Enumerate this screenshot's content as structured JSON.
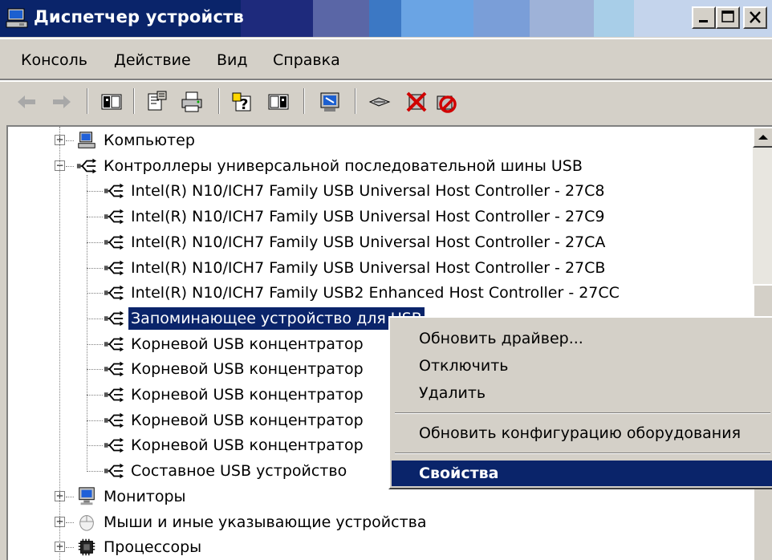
{
  "window": {
    "title": "Диспетчер устройств",
    "title_bar_colors": [
      "#0a246a",
      "#1e2a7c",
      "#3a4690",
      "#5a66a6",
      "#7a8ed0",
      "#3c78c4",
      "#6aa4e4",
      "#9eb2d8",
      "#b4c0e4",
      "#a8cee8",
      "#d8e4f4"
    ],
    "controls": [
      "minimize-icon",
      "maximize-icon",
      "close-icon"
    ]
  },
  "menu": {
    "items": [
      "Консоль",
      "Действие",
      "Вид",
      "Справка"
    ]
  },
  "toolbar": {
    "buttons": [
      "back-arrow-icon",
      "forward-arrow-icon",
      "show-hide-tree-icon",
      "properties-icon",
      "print-icon",
      "help-icon",
      "show-hide-action-pane-icon",
      "scan-hardware-icon",
      "update-driver-icon",
      "uninstall-icon",
      "disable-icon"
    ]
  },
  "tree": {
    "items": [
      {
        "label": "Компьютер",
        "icon": "computer-icon",
        "level": 0,
        "expander": "+"
      },
      {
        "label": "Контроллеры универсальной последовательной шины USB",
        "icon": "usb-icon",
        "level": 0,
        "expander": "−"
      },
      {
        "label": "Intel(R) N10/ICH7 Family USB Universal Host Controller - 27C8",
        "icon": "usb-icon",
        "level": 1
      },
      {
        "label": "Intel(R) N10/ICH7 Family USB Universal Host Controller - 27C9",
        "icon": "usb-icon",
        "level": 1
      },
      {
        "label": "Intel(R) N10/ICH7 Family USB Universal Host Controller - 27CA",
        "icon": "usb-icon",
        "level": 1
      },
      {
        "label": "Intel(R) N10/ICH7 Family USB Universal Host Controller - 27CB",
        "icon": "usb-icon",
        "level": 1
      },
      {
        "label": "Intel(R) N10/ICH7 Family USB2 Enhanced Host Controller - 27CC",
        "icon": "usb-icon",
        "level": 1
      },
      {
        "label": "Запоминающее устройство для USB",
        "icon": "usb-icon",
        "level": 1,
        "selected": true
      },
      {
        "label": "Корневой USB концентратор",
        "icon": "usb-icon",
        "level": 1
      },
      {
        "label": "Корневой USB концентратор",
        "icon": "usb-icon",
        "level": 1
      },
      {
        "label": "Корневой USB концентратор",
        "icon": "usb-icon",
        "level": 1
      },
      {
        "label": "Корневой USB концентратор",
        "icon": "usb-icon",
        "level": 1
      },
      {
        "label": "Корневой USB концентратор",
        "icon": "usb-icon",
        "level": 1
      },
      {
        "label": "Составное USB устройство",
        "icon": "usb-icon",
        "level": 1
      },
      {
        "label": "Мониторы",
        "icon": "monitor-icon",
        "level": 0,
        "expander": "+"
      },
      {
        "label": "Мыши и иные указывающие устройства",
        "icon": "mouse-icon",
        "level": 0,
        "expander": "+"
      },
      {
        "label": "Процессоры",
        "icon": "processor-icon",
        "level": 0,
        "expander": "+"
      }
    ]
  },
  "context_menu": {
    "items": [
      {
        "label": "Обновить драйвер..."
      },
      {
        "label": "Отключить"
      },
      {
        "label": "Удалить"
      },
      {
        "label": "Обновить конфигурацию оборудования"
      },
      {
        "label": "Свойства",
        "bold": true
      }
    ]
  },
  "colors": {
    "selection": "#0a246a",
    "face": "#d4d0c8",
    "tree_background": "#ffffff"
  }
}
